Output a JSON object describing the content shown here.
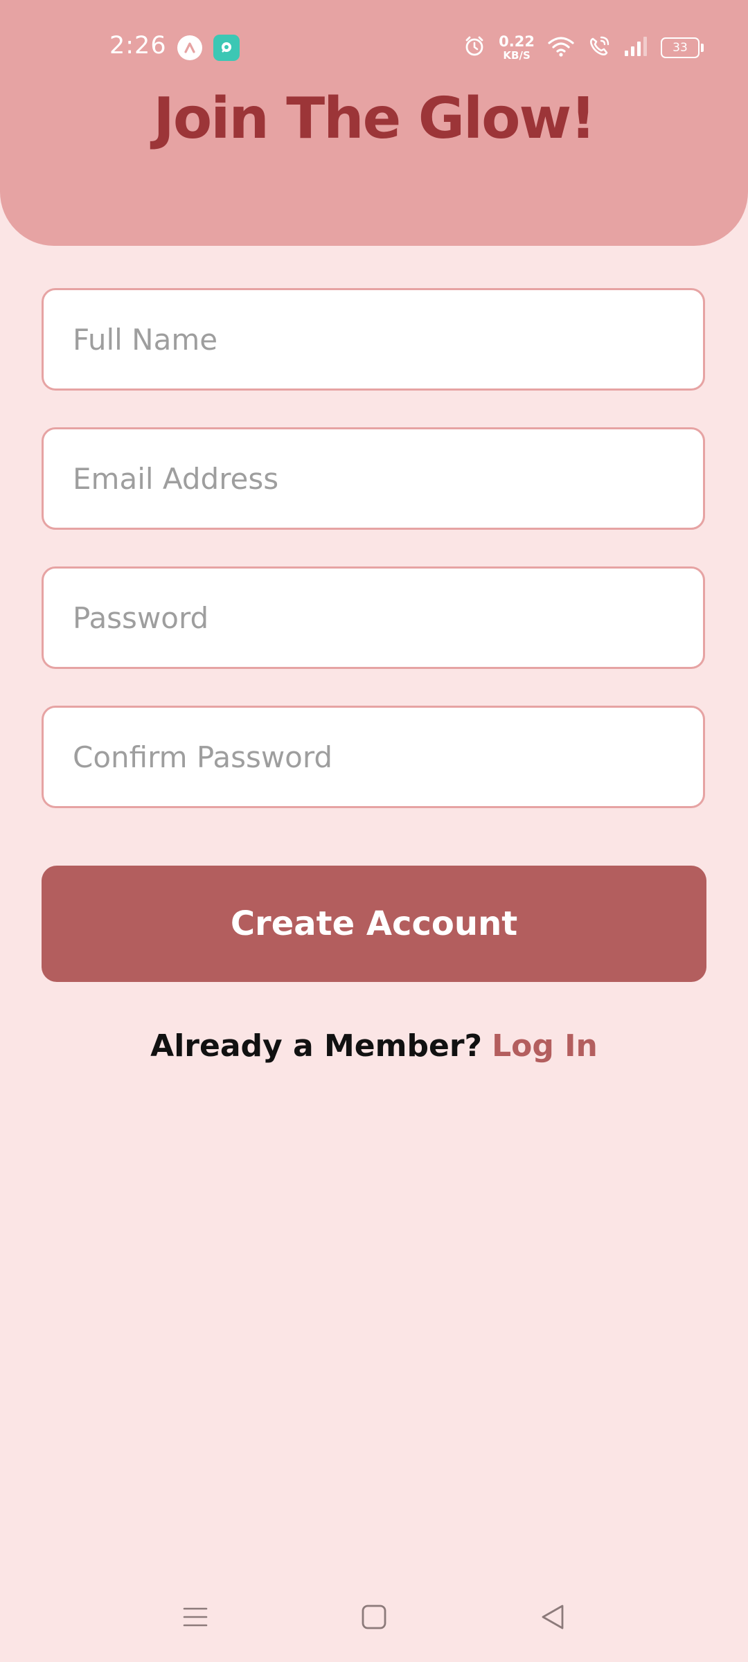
{
  "status_bar": {
    "time": "2:26",
    "net_speed_value": "0.22",
    "net_speed_unit": "KB/S",
    "battery": "33",
    "icons": [
      "app-a-icon",
      "chat-app-icon",
      "alarm-icon",
      "wifi-icon",
      "wifi-call-icon",
      "signal-icon",
      "battery-icon"
    ]
  },
  "header": {
    "title": "Join The Glow!"
  },
  "form": {
    "full_name": {
      "placeholder": "Full Name",
      "value": ""
    },
    "email": {
      "placeholder": "Email Address",
      "value": ""
    },
    "password": {
      "placeholder": "Password",
      "value": ""
    },
    "confirm_password": {
      "placeholder": "Confirm Password",
      "value": ""
    },
    "submit_label": "Create Account"
  },
  "footer": {
    "member_text": "Already a Member?",
    "login_label": "Log In"
  },
  "nav": {
    "icons": [
      "menu-icon",
      "home-icon",
      "back-icon"
    ]
  },
  "colors": {
    "header_bg": "#e6a3a3",
    "page_bg": "#fbe5e5",
    "title": "#9c3538",
    "accent": "#b35e5e",
    "field_border": "#e6a3a3",
    "placeholder": "#9e9e9e"
  }
}
